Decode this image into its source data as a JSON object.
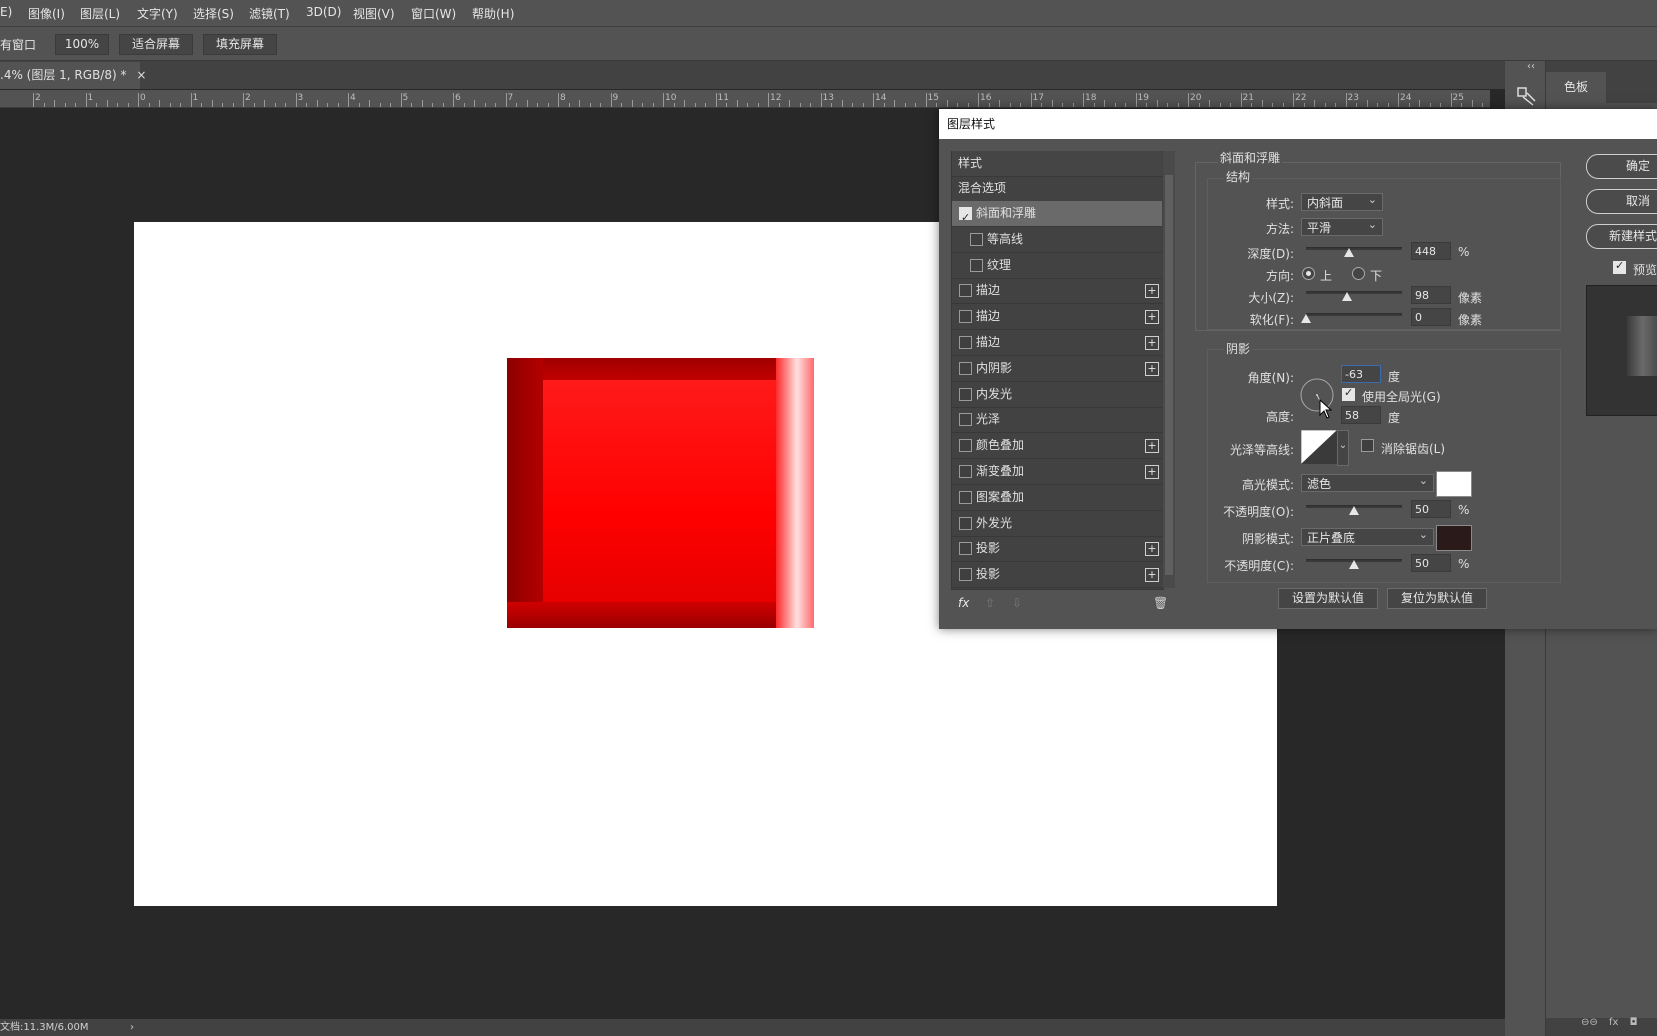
{
  "menu": {
    "items": [
      "E)",
      "图像(I)",
      "图层(L)",
      "文字(Y)",
      "选择(S)",
      "滤镜(T)",
      "3D(D)",
      "视图(V)",
      "窗口(W)",
      "帮助(H)"
    ]
  },
  "options_bar": {
    "window_label": "有窗口",
    "zoom_label": "100%",
    "fit_screen_label": "适合屏幕",
    "fill_screen_label": "填充屏幕"
  },
  "document_tab": {
    "title": ".4% (图层 1, RGB/8) *",
    "close": "×"
  },
  "ruler": {
    "labels": [
      "2",
      "1",
      "0",
      "1",
      "2",
      "3",
      "4",
      "5",
      "6",
      "7",
      "8",
      "9",
      "10",
      "11",
      "12",
      "13",
      "14",
      "15",
      "16",
      "17",
      "18",
      "19",
      "20",
      "21",
      "22",
      "23",
      "24",
      "25"
    ]
  },
  "right_panel": {
    "collapse_glyph": "‹‹",
    "swatch_tab": "色板"
  },
  "status_bar": {
    "doc_info": "文档:11.3M/6.00M",
    "arrow": "›"
  },
  "dialog": {
    "title": "图层样式",
    "styles_header": "样式",
    "blend_options": "混合选项",
    "style_items": [
      {
        "label": "斜面和浮雕",
        "checked": true,
        "plus": false,
        "indent": false,
        "selected": true
      },
      {
        "label": "等高线",
        "checked": false,
        "plus": false,
        "indent": true
      },
      {
        "label": "纹理",
        "checked": false,
        "plus": false,
        "indent": true
      },
      {
        "label": "描边",
        "checked": false,
        "plus": true,
        "indent": false
      },
      {
        "label": "描边",
        "checked": false,
        "plus": true,
        "indent": false
      },
      {
        "label": "描边",
        "checked": false,
        "plus": true,
        "indent": false
      },
      {
        "label": "内阴影",
        "checked": false,
        "plus": true,
        "indent": false
      },
      {
        "label": "内发光",
        "checked": false,
        "plus": false,
        "indent": false
      },
      {
        "label": "光泽",
        "checked": false,
        "plus": false,
        "indent": false
      },
      {
        "label": "颜色叠加",
        "checked": false,
        "plus": true,
        "indent": false
      },
      {
        "label": "渐变叠加",
        "checked": false,
        "plus": true,
        "indent": false
      },
      {
        "label": "图案叠加",
        "checked": false,
        "plus": false,
        "indent": false
      },
      {
        "label": "外发光",
        "checked": false,
        "plus": false,
        "indent": false
      },
      {
        "label": "投影",
        "checked": false,
        "plus": true,
        "indent": false
      },
      {
        "label": "投影",
        "checked": false,
        "plus": true,
        "indent": false
      }
    ],
    "footer_icons": {
      "fx": "fx",
      "up": "⇧",
      "down": "⇩",
      "trash": "🗑"
    },
    "bevel": {
      "section_title": "斜面和浮雕",
      "structure_title": "结构",
      "style_label": "样式:",
      "style_value": "内斜面",
      "technique_label": "方法:",
      "technique_value": "平滑",
      "depth_label": "深度(D):",
      "depth_value": "448",
      "depth_unit": "%",
      "depth_fraction": 0.45,
      "direction_label": "方向:",
      "direction_up": "上",
      "direction_down": "下",
      "direction_selected": "up",
      "size_label": "大小(Z):",
      "size_value": "98",
      "size_unit": "像素",
      "size_fraction": 0.43,
      "soften_label": "软化(F):",
      "soften_value": "0",
      "soften_unit": "像素",
      "soften_fraction": 0.0
    },
    "shading": {
      "title": "阴影",
      "angle_label": "角度(N):",
      "angle_value": "-63",
      "angle_unit": "度",
      "global_light_label": "使用全局光(G)",
      "global_light_checked": true,
      "altitude_label": "高度:",
      "altitude_value": "58",
      "altitude_unit": "度",
      "gloss_contour_label": "光泽等高线:",
      "anti_alias_label": "消除锯齿(L)",
      "highlight_mode_label": "高光模式:",
      "highlight_mode_value": "滤色",
      "highlight_color": "#ffffff",
      "highlight_opacity_label": "不透明度(O):",
      "highlight_opacity_value": "50",
      "highlight_opacity_unit": "%",
      "highlight_opacity_fraction": 0.5,
      "shadow_mode_label": "阴影模式:",
      "shadow_mode_value": "正片叠底",
      "shadow_color": "#2a1a1a",
      "shadow_opacity_label": "不透明度(C):",
      "shadow_opacity_value": "50",
      "shadow_opacity_unit": "%",
      "shadow_opacity_fraction": 0.5
    },
    "make_default": "设置为默认值",
    "reset_default": "复位为默认值",
    "ok": "确定",
    "cancel": "取消",
    "new_style": "新建样式...",
    "preview_label": "预览"
  }
}
